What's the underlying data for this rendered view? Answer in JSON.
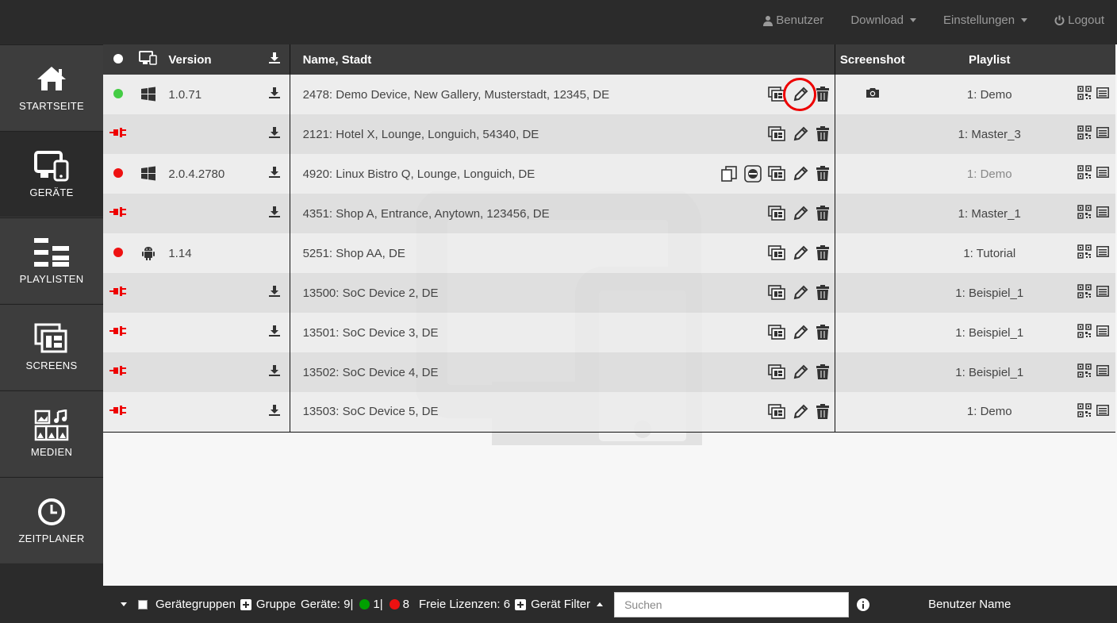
{
  "topnav": {
    "user": "Benutzer",
    "download": "Download",
    "settings": "Einstellungen",
    "logout": "Logout"
  },
  "sidebar": {
    "items": [
      {
        "label": "STARTSEITE",
        "icon": "home-icon"
      },
      {
        "label": "GERÄTE",
        "icon": "devices-icon",
        "active": true
      },
      {
        "label": "PLAYLISTEN",
        "icon": "playlist-icon"
      },
      {
        "label": "SCREENS",
        "icon": "screens-icon"
      },
      {
        "label": "MEDIEN",
        "icon": "media-icon"
      },
      {
        "label": "ZEITPLANER",
        "icon": "clock-icon"
      }
    ]
  },
  "table": {
    "headers": {
      "version": "Version",
      "name": "Name, Stadt",
      "screenshot": "Screenshot",
      "playlist": "Playlist"
    },
    "rows": [
      {
        "status": "green",
        "os": "windows",
        "version": "1.0.71",
        "download": true,
        "name": "2478: Demo Device, New Gallery, Musterstadt, 12345, DE",
        "screenshot": true,
        "playlist": "1: Demo",
        "extra": false,
        "highlight": true
      },
      {
        "status": "unplugged",
        "os": "",
        "version": "",
        "download": true,
        "name": "2121: Hotel X, Lounge, Longuich, 54340, DE",
        "screenshot": false,
        "playlist": "1: Master_3",
        "extra": false
      },
      {
        "status": "red",
        "os": "windows",
        "version": "2.0.4.2780",
        "download": true,
        "name": "4920: Linux Bistro Q, Lounge, Longuich, DE",
        "screenshot": false,
        "playlist": "1: Demo",
        "playlist_dim": true,
        "extra": true
      },
      {
        "status": "unplugged",
        "os": "",
        "version": "",
        "download": true,
        "name": "4351: Shop A, Entrance, Anytown, 123456, DE",
        "screenshot": false,
        "playlist": "1: Master_1",
        "extra": false
      },
      {
        "status": "red",
        "os": "android",
        "version": "1.14",
        "download": false,
        "name": "5251: Shop AA, DE",
        "screenshot": false,
        "playlist": "1: Tutorial",
        "extra": false
      },
      {
        "status": "unplugged",
        "os": "",
        "version": "",
        "download": true,
        "name": "13500: SoC Device 2, DE",
        "screenshot": false,
        "playlist": "1: Beispiel_1",
        "extra": false
      },
      {
        "status": "unplugged",
        "os": "",
        "version": "",
        "download": true,
        "name": "13501: SoC Device 3, DE",
        "screenshot": false,
        "playlist": "1: Beispiel_1",
        "extra": false
      },
      {
        "status": "unplugged",
        "os": "",
        "version": "",
        "download": true,
        "name": "13502: SoC Device 4, DE",
        "screenshot": false,
        "playlist": "1: Beispiel_1",
        "extra": false
      },
      {
        "status": "unplugged",
        "os": "",
        "version": "",
        "download": true,
        "name": "13503: SoC Device 5, DE",
        "screenshot": false,
        "playlist": "1: Demo",
        "extra": false
      }
    ]
  },
  "footer": {
    "groups": "Gerätegruppen",
    "group": "Gruppe",
    "devices": "Geräte: 9|",
    "online": "1|",
    "offline": "8",
    "licenses": "Freie Lizenzen: 6",
    "filter": "Gerät Filter",
    "search_placeholder": "Suchen",
    "username": "Benutzer Name"
  },
  "colors": {
    "online": "#44cc44",
    "offline": "#ee1111",
    "footer_online": "#00a000",
    "highlight_ring": "#e00000"
  }
}
